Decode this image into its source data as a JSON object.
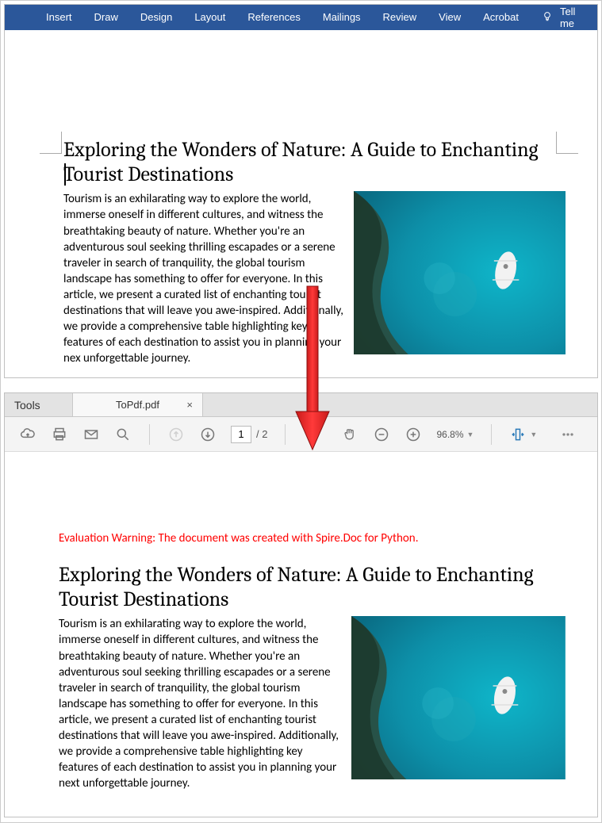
{
  "word": {
    "ribbon": {
      "tabs": [
        "Insert",
        "Draw",
        "Design",
        "Layout",
        "References",
        "Mailings",
        "Review",
        "View",
        "Acrobat"
      ],
      "tellme": "Tell me"
    },
    "document": {
      "title": "Exploring the Wonders of Nature: A Guide to Enchanting Tourist Destinations",
      "body": "Tourism is an exhilarating way to explore the world, immerse oneself in different cultures, and witness the breathtaking beauty of nature. Whether you're an adventurous soul seeking thrilling escapades or a serene traveler in search of tranquility, the global tourism landscape has something to offer for everyone. In this article, we present a curated list of enchanting tourist destinations that will leave you awe-inspired. Additionally, we provide a comprehensive table highlighting key features of each destination to assist you in planning your nex unforgettable journey.",
      "image_desc": "aerial-ocean-boat-reef"
    }
  },
  "pdf": {
    "tools_label": "Tools",
    "filename": "ToPdf.pdf",
    "toolbar": {
      "page_current": "1",
      "page_count": "/ 2",
      "zoom": "96.8%"
    },
    "warning": "Evaluation Warning: The document was created with Spire.Doc for Python.",
    "document": {
      "title": "Exploring the Wonders of Nature: A Guide to Enchanting Tourist Destinations",
      "body": "Tourism is an exhilarating way to explore the world, immerse oneself in different cultures, and witness the breathtaking beauty of nature. Whether you're an adventurous soul seeking thrilling escapades or a serene traveler in search of tranquility, the global tourism landscape has something to offer for everyone. In this article, we present a curated list of enchanting tourist destinations that will leave you awe-inspired. Additionally, we provide a comprehensive table highlighting key features of each destination to assist you in planning your next unforgettable journey.",
      "image_desc": "aerial-ocean-boat-reef"
    }
  }
}
